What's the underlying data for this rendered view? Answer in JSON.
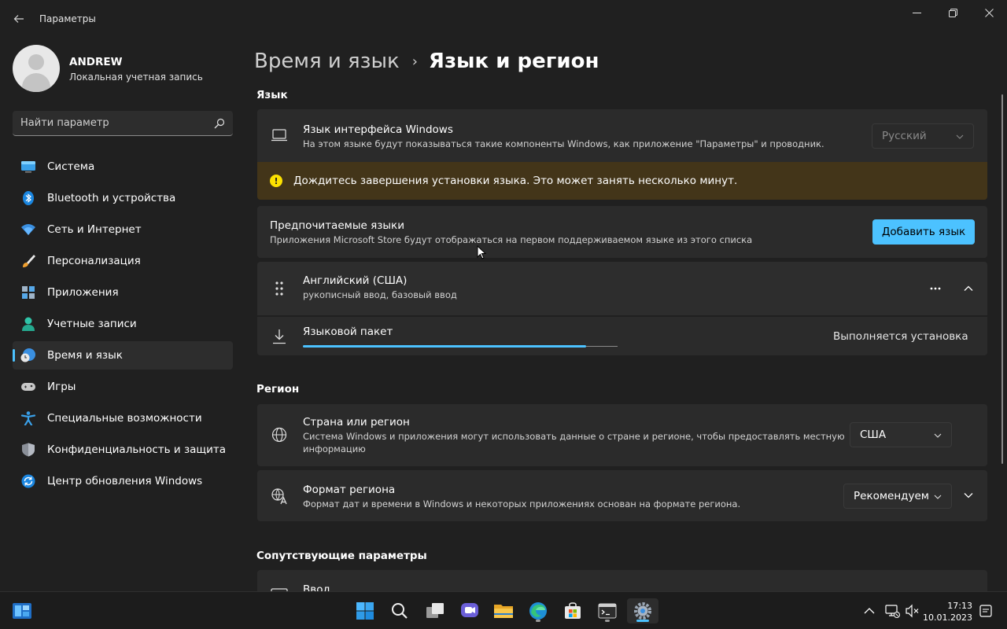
{
  "app": {
    "title": "Параметры"
  },
  "user": {
    "name": "ANDREW",
    "account": "Локальная учетная запись"
  },
  "search": {
    "placeholder": "Найти параметр",
    "value": ""
  },
  "sidebar": {
    "items": [
      {
        "label": "Система",
        "icon": "display-icon"
      },
      {
        "label": "Bluetooth и устройства",
        "icon": "bluetooth-icon"
      },
      {
        "label": "Сеть и Интернет",
        "icon": "wifi-icon"
      },
      {
        "label": "Персонализация",
        "icon": "brush-icon"
      },
      {
        "label": "Приложения",
        "icon": "apps-icon"
      },
      {
        "label": "Учетные записи",
        "icon": "person-icon"
      },
      {
        "label": "Время и язык",
        "icon": "globe-clock-icon",
        "selected": true
      },
      {
        "label": "Игры",
        "icon": "gamepad-icon"
      },
      {
        "label": "Специальные возможности",
        "icon": "accessibility-icon"
      },
      {
        "label": "Конфиденциальность и защита",
        "icon": "shield-icon"
      },
      {
        "label": "Центр обновления Windows",
        "icon": "update-icon"
      }
    ]
  },
  "breadcrumb": {
    "parent": "Время и язык",
    "separator": "›",
    "current": "Язык и регион"
  },
  "language": {
    "section_title": "Язык",
    "display_language": {
      "title": "Язык интерфейса Windows",
      "description": "На этом языке будут показываться такие компоненты Windows, как приложение \"Параметры\" и проводник.",
      "value": "Русский"
    },
    "warning": "Дождитесь завершения установки языка. Это может занять несколько минут.",
    "preferred": {
      "title": "Предпочитаемые языки",
      "description": "Приложения Microsoft Store будут отображаться на первом поддерживаемом языке из этого списка",
      "add_button": "Добавить язык"
    },
    "english": {
      "title": "Английский (США)",
      "description": "рукописный ввод, базовый ввод",
      "more": "..."
    },
    "language_pack": {
      "title": "Языковой пакет",
      "status": "Выполняется установка",
      "progress": 0.9
    }
  },
  "region": {
    "section_title": "Регион",
    "country": {
      "title": "Страна или регион",
      "description_line1": "Система Windows и приложения могут использовать данные о стране и регионе, чтобы предоставлять местную",
      "description_line2": "информацию",
      "value": "США"
    },
    "format": {
      "title": "Формат региона",
      "description": "Формат дат и времени в Windows и некоторых приложениях основан на формате региона.",
      "value": "Рекомендуем"
    }
  },
  "related": {
    "section_title": "Сопутствующие параметры",
    "input": {
      "title": "Ввод"
    }
  },
  "taskbar": {
    "apps": [
      "start-icon",
      "search-icon",
      "task-view-icon",
      "chat-icon",
      "file-explorer-icon",
      "edge-icon",
      "store-icon",
      "terminal-icon",
      "settings-icon"
    ],
    "time": "17:13",
    "date": "10.01.2023"
  },
  "colors": {
    "accent": "#4cc2ff",
    "background": "#202020",
    "card": "#2b2b2b",
    "warning_bg": "#433519"
  }
}
